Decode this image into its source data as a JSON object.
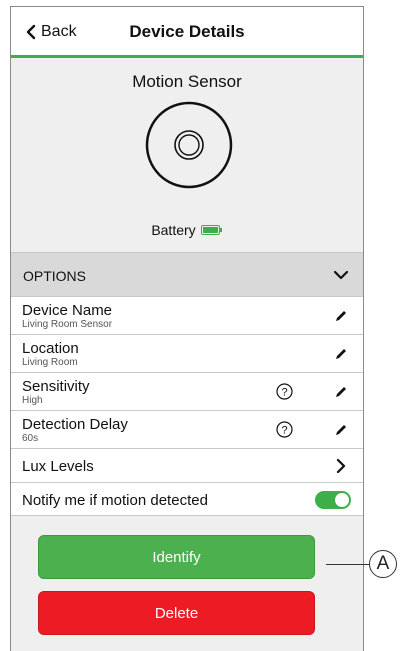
{
  "header": {
    "back_label": "Back",
    "title": "Device Details"
  },
  "device": {
    "name": "Motion Sensor",
    "battery_label": "Battery",
    "battery_status_color": "#3dae49"
  },
  "options": {
    "title": "OPTIONS",
    "rows": [
      {
        "label": "Device Name",
        "value": "Living Room Sensor"
      },
      {
        "label": "Location",
        "value": "Living Room"
      },
      {
        "label": "Sensitivity",
        "value": "High"
      },
      {
        "label": "Detection Delay",
        "value": "60s"
      },
      {
        "label": "Lux Levels"
      },
      {
        "label": "Notify me if motion detected",
        "toggle_on": true
      }
    ]
  },
  "actions": {
    "identify_label": "Identify",
    "delete_label": "Delete"
  },
  "callout": {
    "label": "A"
  },
  "colors": {
    "accent_green": "#4cb04e",
    "danger_red": "#ed1c24"
  }
}
